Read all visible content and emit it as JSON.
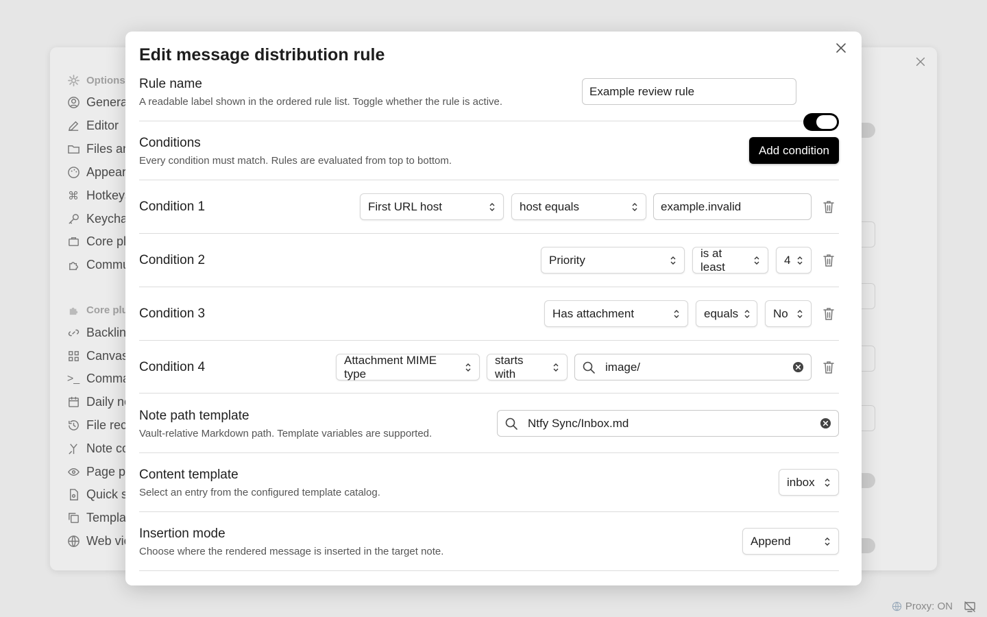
{
  "background": {
    "sidebar": {
      "group1": "Options",
      "items1": [
        "General",
        "Editor",
        "Files and links",
        "Appearance",
        "Hotkeys",
        "Keychain",
        "Core plugins",
        "Community plugins"
      ],
      "group2": "Core plugins",
      "items2": [
        "Backlinks",
        "Canvas",
        "Command palette",
        "Daily notes",
        "File recovery",
        "Note composer",
        "Page preview",
        "Quick switcher",
        "Templates",
        "Web viewer"
      ]
    }
  },
  "modal": {
    "title": "Edit message distribution rule",
    "rule_name": {
      "label": "Rule name",
      "desc": "A readable label shown in the ordered rule list. Toggle whether the rule is active.",
      "value": "Example review rule",
      "enabled": true
    },
    "conditions": {
      "label": "Conditions",
      "desc": "Every condition must match. Rules are evaluated from top to bottom.",
      "add_button": "Add condition",
      "items": [
        {
          "label": "Condition 1",
          "field": "First URL host",
          "operator": "host equals",
          "value": "example.invalid"
        },
        {
          "label": "Condition 2",
          "field": "Priority",
          "operator": "is at least",
          "value": "4"
        },
        {
          "label": "Condition 3",
          "field": "Has attachment",
          "operator": "equals",
          "value": "No"
        },
        {
          "label": "Condition 4",
          "field": "Attachment MIME type",
          "operator": "starts with",
          "value": "image/"
        }
      ]
    },
    "note_path": {
      "label": "Note path template",
      "desc": "Vault-relative Markdown path. Template variables are supported.",
      "value": "Ntfy Sync/Inbox.md"
    },
    "content_template": {
      "label": "Content template",
      "desc": "Select an entry from the configured template catalog.",
      "value": "inbox"
    },
    "insertion_mode": {
      "label": "Insertion mode",
      "desc": "Choose where the rendered message is inserted in the target note.",
      "value": "Append"
    }
  },
  "statusbar": {
    "proxy": "Proxy: ON"
  }
}
